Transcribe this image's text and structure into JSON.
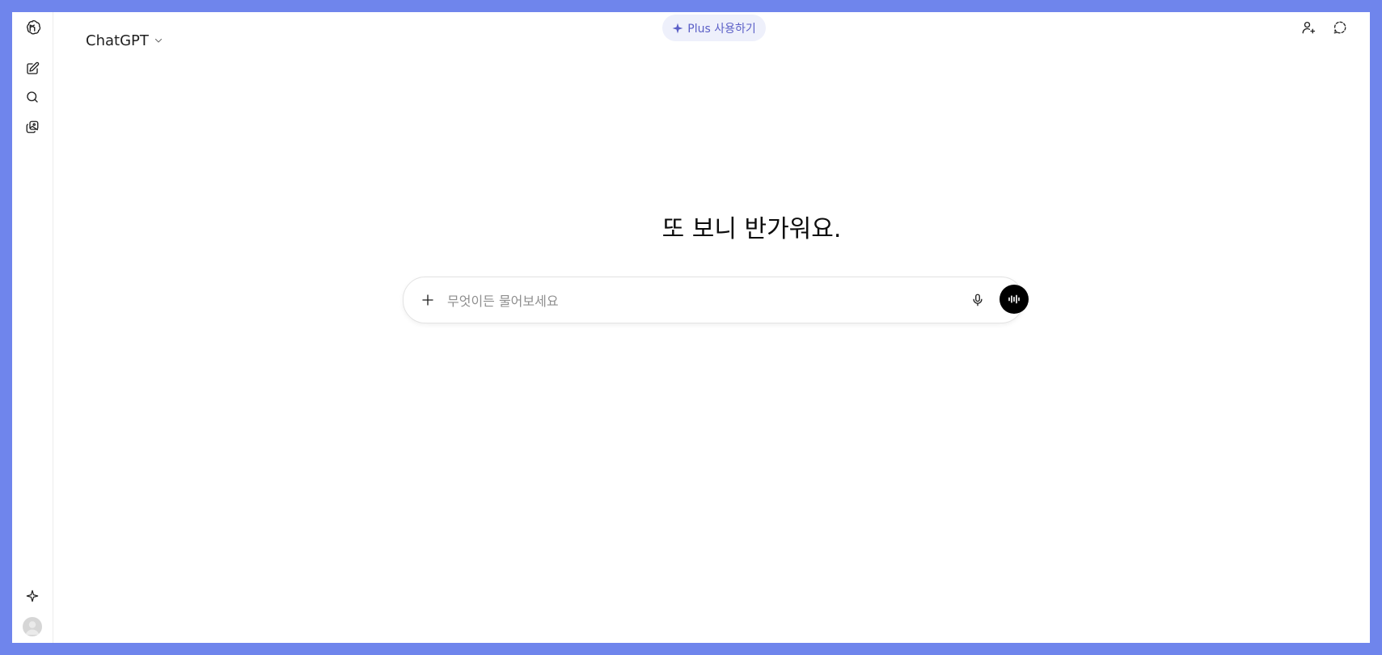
{
  "app": {
    "model_name": "ChatGPT"
  },
  "header": {
    "upgrade_label": "Plus 사용하기"
  },
  "main": {
    "greeting": "또 보니 반가워요.",
    "composer": {
      "placeholder": "무엇이든 물어보세요",
      "value": ""
    }
  },
  "icons": {
    "logo": "openai-logo-icon",
    "new_chat": "new-chat-icon",
    "search": "search-icon",
    "library": "image-library-icon",
    "sparkle": "sparkle-icon",
    "add_user": "add-user-icon",
    "temporary_chat": "temporary-chat-icon",
    "attach": "plus-icon",
    "mic": "microphone-icon",
    "voice": "voice-mode-icon"
  },
  "colors": {
    "background": "#6f85ec",
    "accent": "#5b5fc7",
    "pill_bg": "#eef0fb"
  }
}
